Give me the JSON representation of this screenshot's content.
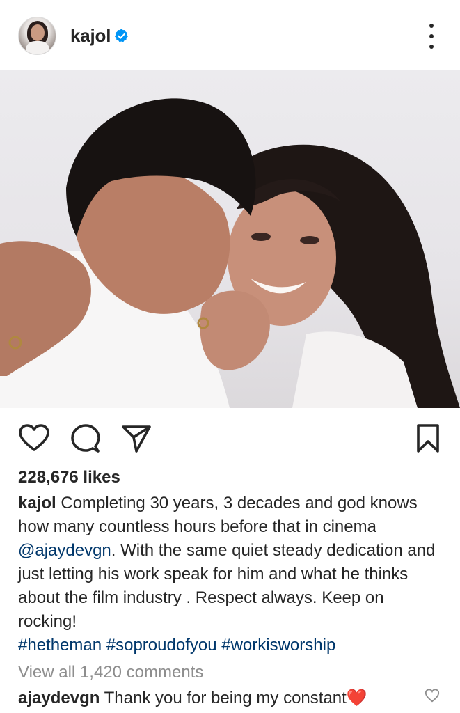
{
  "post": {
    "username": "kajol",
    "verified": true
  },
  "actions": {
    "like_icon": "heart-outline-icon",
    "comment_icon": "comment-bubble-icon",
    "share_icon": "paper-plane-icon",
    "save_icon": "bookmark-icon"
  },
  "likes_text": "228,676 likes",
  "caption": {
    "username": "kajol",
    "text_1": "Completing 30 years, 3 decades and god knows how many countless hours before that in cinema ",
    "mention": "@ajaydevgn",
    "text_2": ". With the same quiet steady dedication and just letting his work speak for him and what he thinks about the film industry . Respect always. Keep on rocking!",
    "hashtags": [
      "#hetheman",
      "#soproudofyou",
      "#workisworship"
    ]
  },
  "view_comments": "View all 1,420 comments",
  "top_comment": {
    "username": "ajaydevgn",
    "text": "Thank you for being my constant",
    "emoji": "❤️"
  },
  "colors": {
    "link": "#00376b",
    "muted": "#8e8e8e",
    "verified": "#0095f6",
    "text": "#262626"
  }
}
